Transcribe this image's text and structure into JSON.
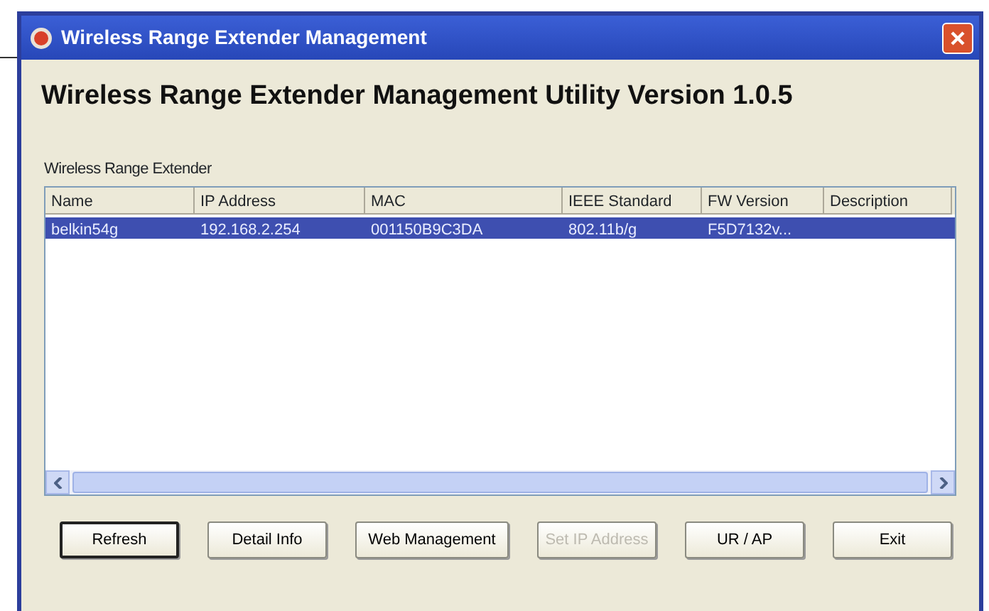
{
  "window": {
    "title": "Wireless Range Extender Management"
  },
  "heading": "Wireless Range Extender Management Utility Version 1.0.5",
  "group_label": "Wireless Range Extender",
  "table": {
    "columns": [
      "Name",
      "IP Address",
      "MAC",
      "IEEE Standard",
      "FW Version",
      "Description"
    ],
    "rows": [
      {
        "cells": [
          "belkin54g",
          "192.168.2.254",
          "001150B9C3DA",
          "802.11b/g",
          "F5D7132v...",
          ""
        ],
        "selected": true
      }
    ]
  },
  "buttons": [
    {
      "label": "Refresh",
      "default": true,
      "disabled": false
    },
    {
      "label": "Detail Info",
      "default": false,
      "disabled": false
    },
    {
      "label": "Web Management",
      "default": false,
      "disabled": false
    },
    {
      "label": "Set IP Address",
      "default": false,
      "disabled": true
    },
    {
      "label": "UR / AP",
      "default": false,
      "disabled": false
    },
    {
      "label": "Exit",
      "default": false,
      "disabled": false
    }
  ]
}
